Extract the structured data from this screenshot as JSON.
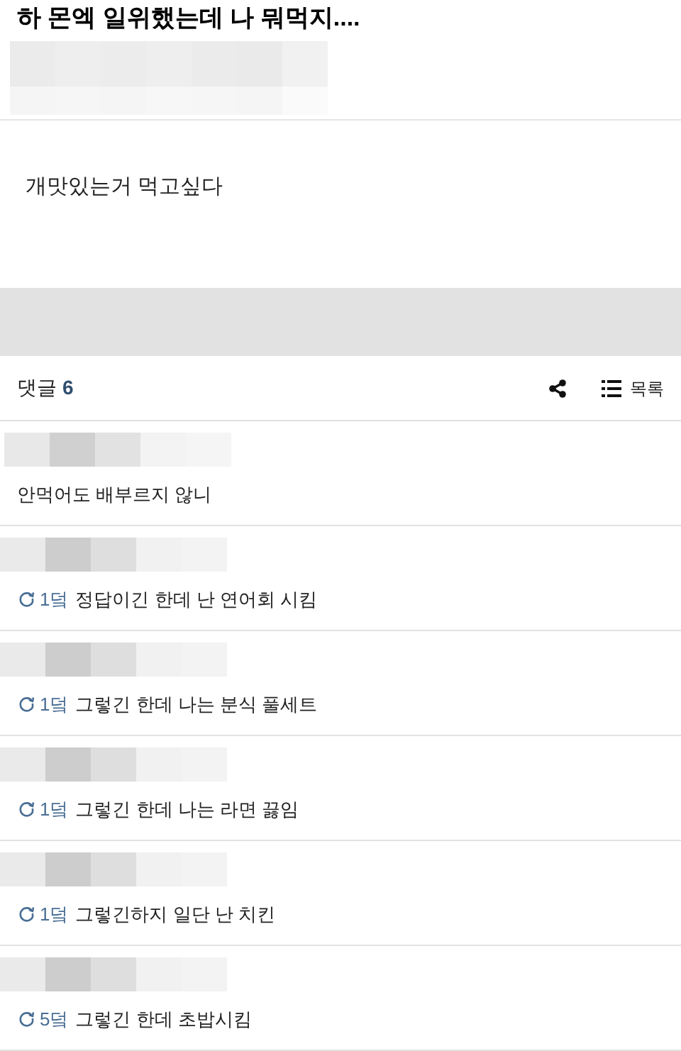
{
  "post": {
    "title": "하 몬엑 일위했는데 나 뭐먹지....",
    "body": "개맛있는거 먹고싶다"
  },
  "comments_header": {
    "label": "댓글",
    "count": "6",
    "list_label": "목록"
  },
  "comments": [
    {
      "kind": "comment",
      "text": "안먹어도 배부르지 않니"
    },
    {
      "kind": "reply",
      "reply_to": "1덬",
      "text": "정답이긴 한데 난 연어회 시킴"
    },
    {
      "kind": "reply",
      "reply_to": "1덬",
      "text": "그렇긴 한데 나는 분식 풀세트"
    },
    {
      "kind": "reply",
      "reply_to": "1덬",
      "text": "그렇긴 한데 나는 라면 끓임"
    },
    {
      "kind": "reply",
      "reply_to": "1덬",
      "text": "그렇긴하지 일단 난 치킨"
    },
    {
      "kind": "reply",
      "reply_to": "5덬",
      "text": "그렇긴 한데 초밥시킴"
    }
  ]
}
